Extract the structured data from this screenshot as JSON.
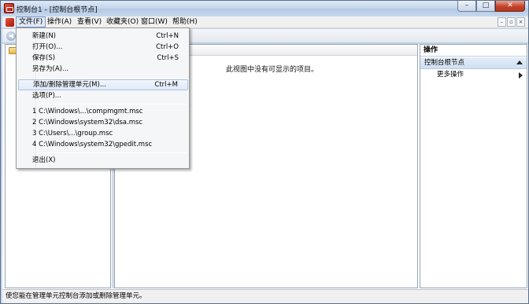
{
  "window": {
    "title": "控制台1 - [控制台根节点]",
    "caption": {
      "minimize": "–",
      "maximize": "□",
      "close": "✕"
    }
  },
  "menubar": {
    "items": [
      "文件(F)",
      "操作(A)",
      "查看(V)",
      "收藏夹(O)",
      "窗口(W)",
      "帮助(H)"
    ],
    "mdi": {
      "minimize": "–",
      "restore": "▫",
      "close": "×"
    }
  },
  "toolbar": {
    "back": "◀"
  },
  "file_menu": {
    "items": [
      {
        "label": "新建(N)",
        "shortcut": "Ctrl+N"
      },
      {
        "label": "打开(O)...",
        "shortcut": "Ctrl+O"
      },
      {
        "label": "保存(S)",
        "shortcut": "Ctrl+S"
      },
      {
        "label": "另存为(A)...",
        "shortcut": ""
      },
      {
        "label": "添加/删除管理单元(M)...",
        "shortcut": "Ctrl+M"
      },
      {
        "label": "选项(P)...",
        "shortcut": ""
      },
      {
        "label": "1 C:\\Windows\\...\\compmgmt.msc",
        "shortcut": ""
      },
      {
        "label": "2 C:\\Windows\\system32\\dsa.msc",
        "shortcut": ""
      },
      {
        "label": "3 C:\\Users\\...\\group.msc",
        "shortcut": ""
      },
      {
        "label": "4 C:\\Windows\\system32\\gpedit.msc",
        "shortcut": ""
      },
      {
        "label": "退出(X)",
        "shortcut": ""
      }
    ]
  },
  "center": {
    "empty_message": "此视图中没有可显示的项目。"
  },
  "actions": {
    "title": "操作",
    "section": "控制台根节点",
    "more": "更多操作"
  },
  "status": {
    "text": "使您能在管理单元控制台添加或删除管理单元。"
  }
}
